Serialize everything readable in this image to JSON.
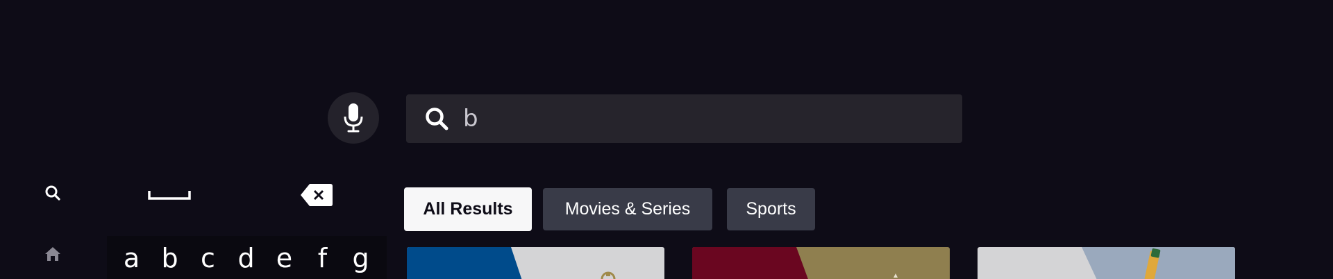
{
  "rail": {
    "items": [
      {
        "name": "search",
        "icon": "search-icon"
      },
      {
        "name": "home",
        "icon": "home-icon"
      }
    ]
  },
  "keyboard": {
    "space_icon": "space-bar-icon",
    "backspace_icon": "backspace-icon",
    "letters": [
      "a",
      "b",
      "c",
      "d",
      "e",
      "f",
      "g"
    ]
  },
  "search": {
    "mic_icon": "microphone-icon",
    "search_icon": "search-icon",
    "query": "b"
  },
  "tabs": [
    {
      "label": "All Results",
      "active": true
    },
    {
      "label": "Movies & Series",
      "active": false
    },
    {
      "label": "Sports",
      "active": false
    }
  ],
  "colors": {
    "background": "#0e0c17",
    "search_bar": "#26242c",
    "tab_inactive": "#393b48",
    "tab_active": "#f7f7f8",
    "tile1_blue": "#004b8b",
    "tile2_maroon": "#6a0620",
    "tile2_gold": "#8f7f4f",
    "tile_grey": "#d4d4d6"
  }
}
